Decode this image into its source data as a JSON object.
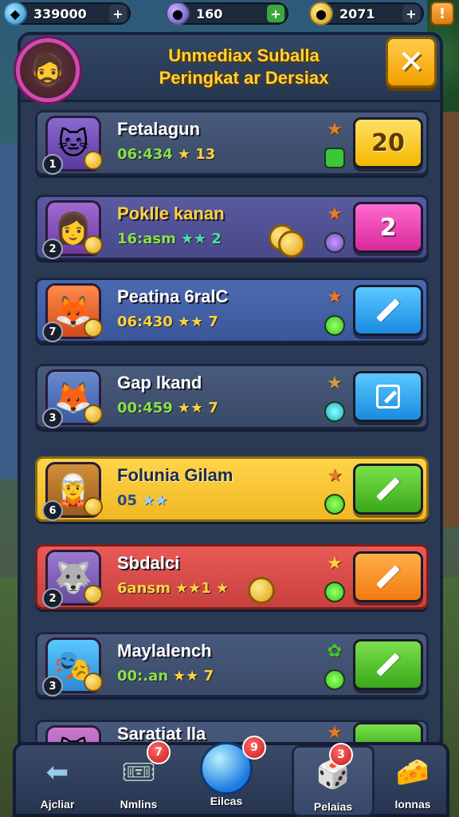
{
  "resources": {
    "gems": "339000",
    "energy": "160",
    "coins": "2071",
    "gem_plus": "+",
    "energy_plus": "+",
    "coin_plus": "+",
    "alert": "!"
  },
  "header": {
    "title_line1": "Unmediax Suballa",
    "title_line2": "Peringkat ar Dersiax",
    "close_label": "✕"
  },
  "rows": [
    {
      "name": "Fetalagun",
      "score": "06:434",
      "stars": "★ 13",
      "rank": "1",
      "action": "20",
      "style": "yellow"
    },
    {
      "name": "Poklle kanan",
      "score": "16:asm",
      "stars": "★★ 2",
      "rank": "2",
      "action": "2",
      "style": "pink"
    },
    {
      "name": "Peatina 6ralC",
      "score": "06:430",
      "stars": "★★ 7",
      "rank": "7",
      "action": "",
      "style": "blue"
    },
    {
      "name": "Gap lkand",
      "score": "00:459",
      "stars": "★★ 7",
      "rank": "3",
      "action": "",
      "style": "blue"
    },
    {
      "name": "Folunia Gilam",
      "score": "05",
      "stars": "★★",
      "rank": "6",
      "action": "",
      "style": "green"
    },
    {
      "name": "Sbdalci",
      "score": "6ansm",
      "stars": "★★1 ★",
      "rank": "2",
      "action": "",
      "style": "orange"
    },
    {
      "name": "Maylalench",
      "score": "00:.an",
      "stars": "★★ 7",
      "rank": "3",
      "action": "",
      "style": "green"
    },
    {
      "name": "Saratiat lla",
      "score": "",
      "stars": "",
      "rank": "",
      "action": "",
      "style": "green"
    }
  ],
  "nav": {
    "items": [
      {
        "label": "Ajcliar",
        "badge": ""
      },
      {
        "label": "Nmlins",
        "badge": "7"
      },
      {
        "label": "Eilcas",
        "badge": "9"
      },
      {
        "label": "Pelaias",
        "badge": "3"
      },
      {
        "label": "Ionnas",
        "badge": ""
      }
    ]
  }
}
